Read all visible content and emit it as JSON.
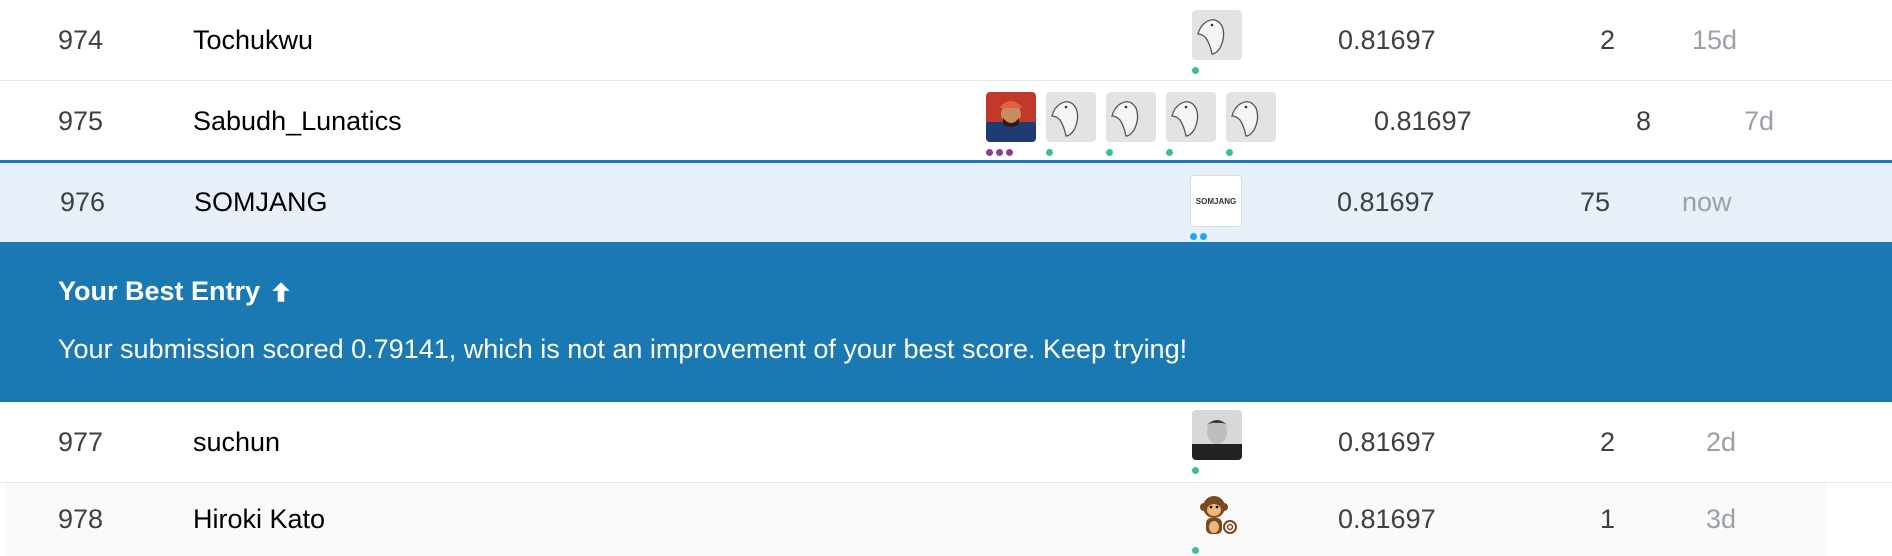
{
  "rows": [
    {
      "rank": "974",
      "name": "Tochukwu",
      "score": "0.81697",
      "entries": "2",
      "last": "15d"
    },
    {
      "rank": "975",
      "name": "Sabudh_Lunatics",
      "score": "0.81697",
      "entries": "8",
      "last": "7d"
    },
    {
      "rank": "976",
      "name": "SOMJANG",
      "score": "0.81697",
      "entries": "75",
      "last": "now",
      "avatar_text": "SOMJANG"
    },
    {
      "rank": "977",
      "name": "suchun",
      "score": "0.81697",
      "entries": "2",
      "last": "2d"
    },
    {
      "rank": "978",
      "name": "Hiroki Kato",
      "score": "0.81697",
      "entries": "1",
      "last": "3d"
    }
  ],
  "banner": {
    "title": "Your Best Entry",
    "message": "Your submission scored 0.79141, which is not an improvement of your best score. Keep trying!",
    "icon": "arrow-up-icon",
    "color": "#1a79b2"
  },
  "colors": {
    "selected_row": "#e7f0f9",
    "accent": "#1f78b4",
    "dot_green": "#3cc08a",
    "dot_blue": "#20a4ff",
    "dot_purple": "#8c3f8c"
  }
}
